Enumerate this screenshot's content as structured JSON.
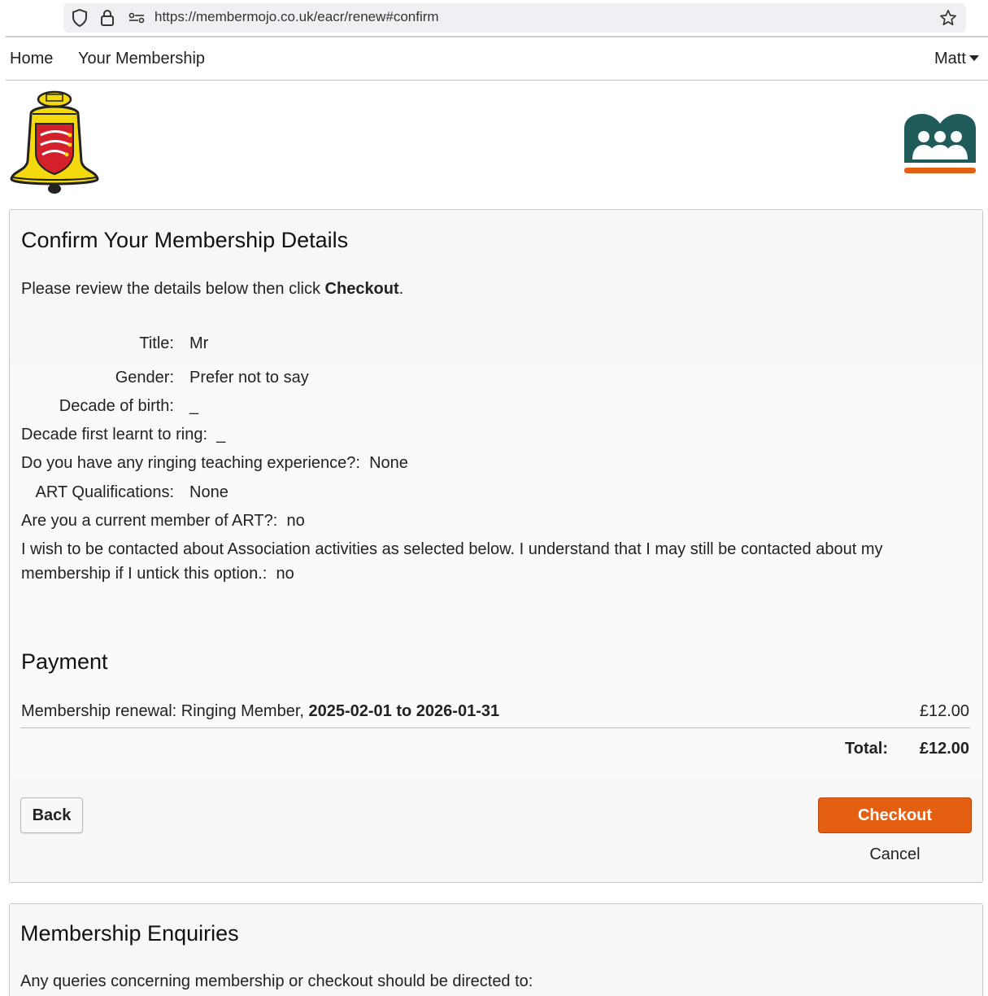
{
  "browser": {
    "url": "https://membermojo.co.uk/eacr/renew#confirm"
  },
  "nav": {
    "home": "Home",
    "your_membership": "Your Membership",
    "user": "Matt"
  },
  "confirm": {
    "heading": "Confirm Your Membership Details",
    "intro_prefix": "Please review the details below then click ",
    "intro_bold": "Checkout",
    "intro_suffix": ".",
    "fields": {
      "title_label": "Title:",
      "title_value": "Mr",
      "gender_label": "Gender:",
      "gender_value": "Prefer not to say",
      "decade_birth_label": "Decade of birth:",
      "decade_birth_value": "_",
      "decade_ring_label": "Decade first learnt to ring:",
      "decade_ring_value": "_",
      "teaching_label": "Do you have any ringing teaching experience?:",
      "teaching_value": "None",
      "art_qual_label": "ART Qualifications:",
      "art_qual_value": "None",
      "art_member_label": "Are you a current member of ART?:",
      "art_member_value": "no",
      "contact_label_line1": "I wish to be contacted about Association activities as selected below. I understand that I may still be contacted about my",
      "contact_label_line2": "membership if I untick this option.:",
      "contact_value": "no"
    }
  },
  "payment": {
    "heading": "Payment",
    "item_prefix": "Membership renewal: Ringing Member, ",
    "item_dates": "2025-02-01 to 2026-01-31",
    "item_amount": "£12.00",
    "total_label": "Total:",
    "total_amount": "£12.00"
  },
  "actions": {
    "back": "Back",
    "checkout": "Checkout",
    "cancel": "Cancel"
  },
  "enquiries": {
    "heading": "Membership Enquiries",
    "text": "Any queries concerning membership or checkout should be directed to:"
  },
  "colors": {
    "accent": "#e45f12",
    "brand_teal": "#1f5b5b"
  }
}
